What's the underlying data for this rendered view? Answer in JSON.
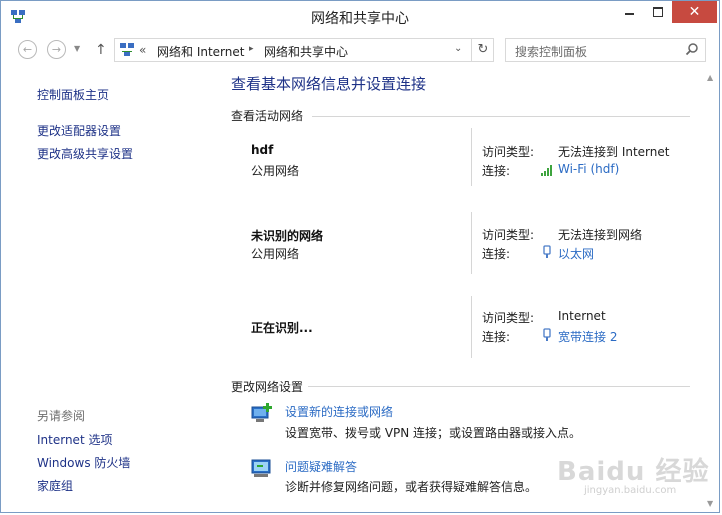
{
  "window": {
    "title": "网络和共享中心"
  },
  "address": {
    "crumbs": [
      "网络和 Internet",
      "网络和共享中心"
    ],
    "sep": "«",
    "search_placeholder": "搜索控制面板"
  },
  "sidebar": {
    "home": "控制面板主页",
    "links": [
      "更改适配器设置",
      "更改高级共享设置"
    ],
    "see_also_head": "另请参阅",
    "see_also": [
      "Internet 选项",
      "Windows 防火墙",
      "家庭组"
    ]
  },
  "main": {
    "title": "查看基本网络信息并设置连接",
    "active_head": "查看活动网络",
    "access_label": "访问类型:",
    "conn_label": "连接:",
    "networks": [
      {
        "name": "hdf",
        "type": "公用网络",
        "access": "无法连接到 Internet",
        "conn": "Wi-Fi (hdf)",
        "icon": "wifi-signal-icon"
      },
      {
        "name": "未识别的网络",
        "type": "公用网络",
        "access": "无法连接到网络",
        "conn": "以太网",
        "icon": "ethernet-icon"
      },
      {
        "name": "正在识别...",
        "type": "",
        "access": "Internet",
        "conn": "宽带连接 2",
        "icon": "broadband-icon"
      }
    ],
    "change_head": "更改网络设置",
    "tasks": [
      {
        "link": "设置新的连接或网络",
        "desc": "设置宽带、拨号或 VPN 连接；或设置路由器或接入点。",
        "icon": "new-connection-icon"
      },
      {
        "link": "问题疑难解答",
        "desc": "诊断并修复网络问题，或者获得疑难解答信息。",
        "icon": "troubleshoot-icon"
      }
    ]
  },
  "watermark": {
    "brand": "Baidu 经验",
    "url": "jingyan.baidu.com"
  },
  "colors": {
    "link": "#2b6bc4",
    "title": "#1e3287",
    "close": "#c74a40"
  }
}
